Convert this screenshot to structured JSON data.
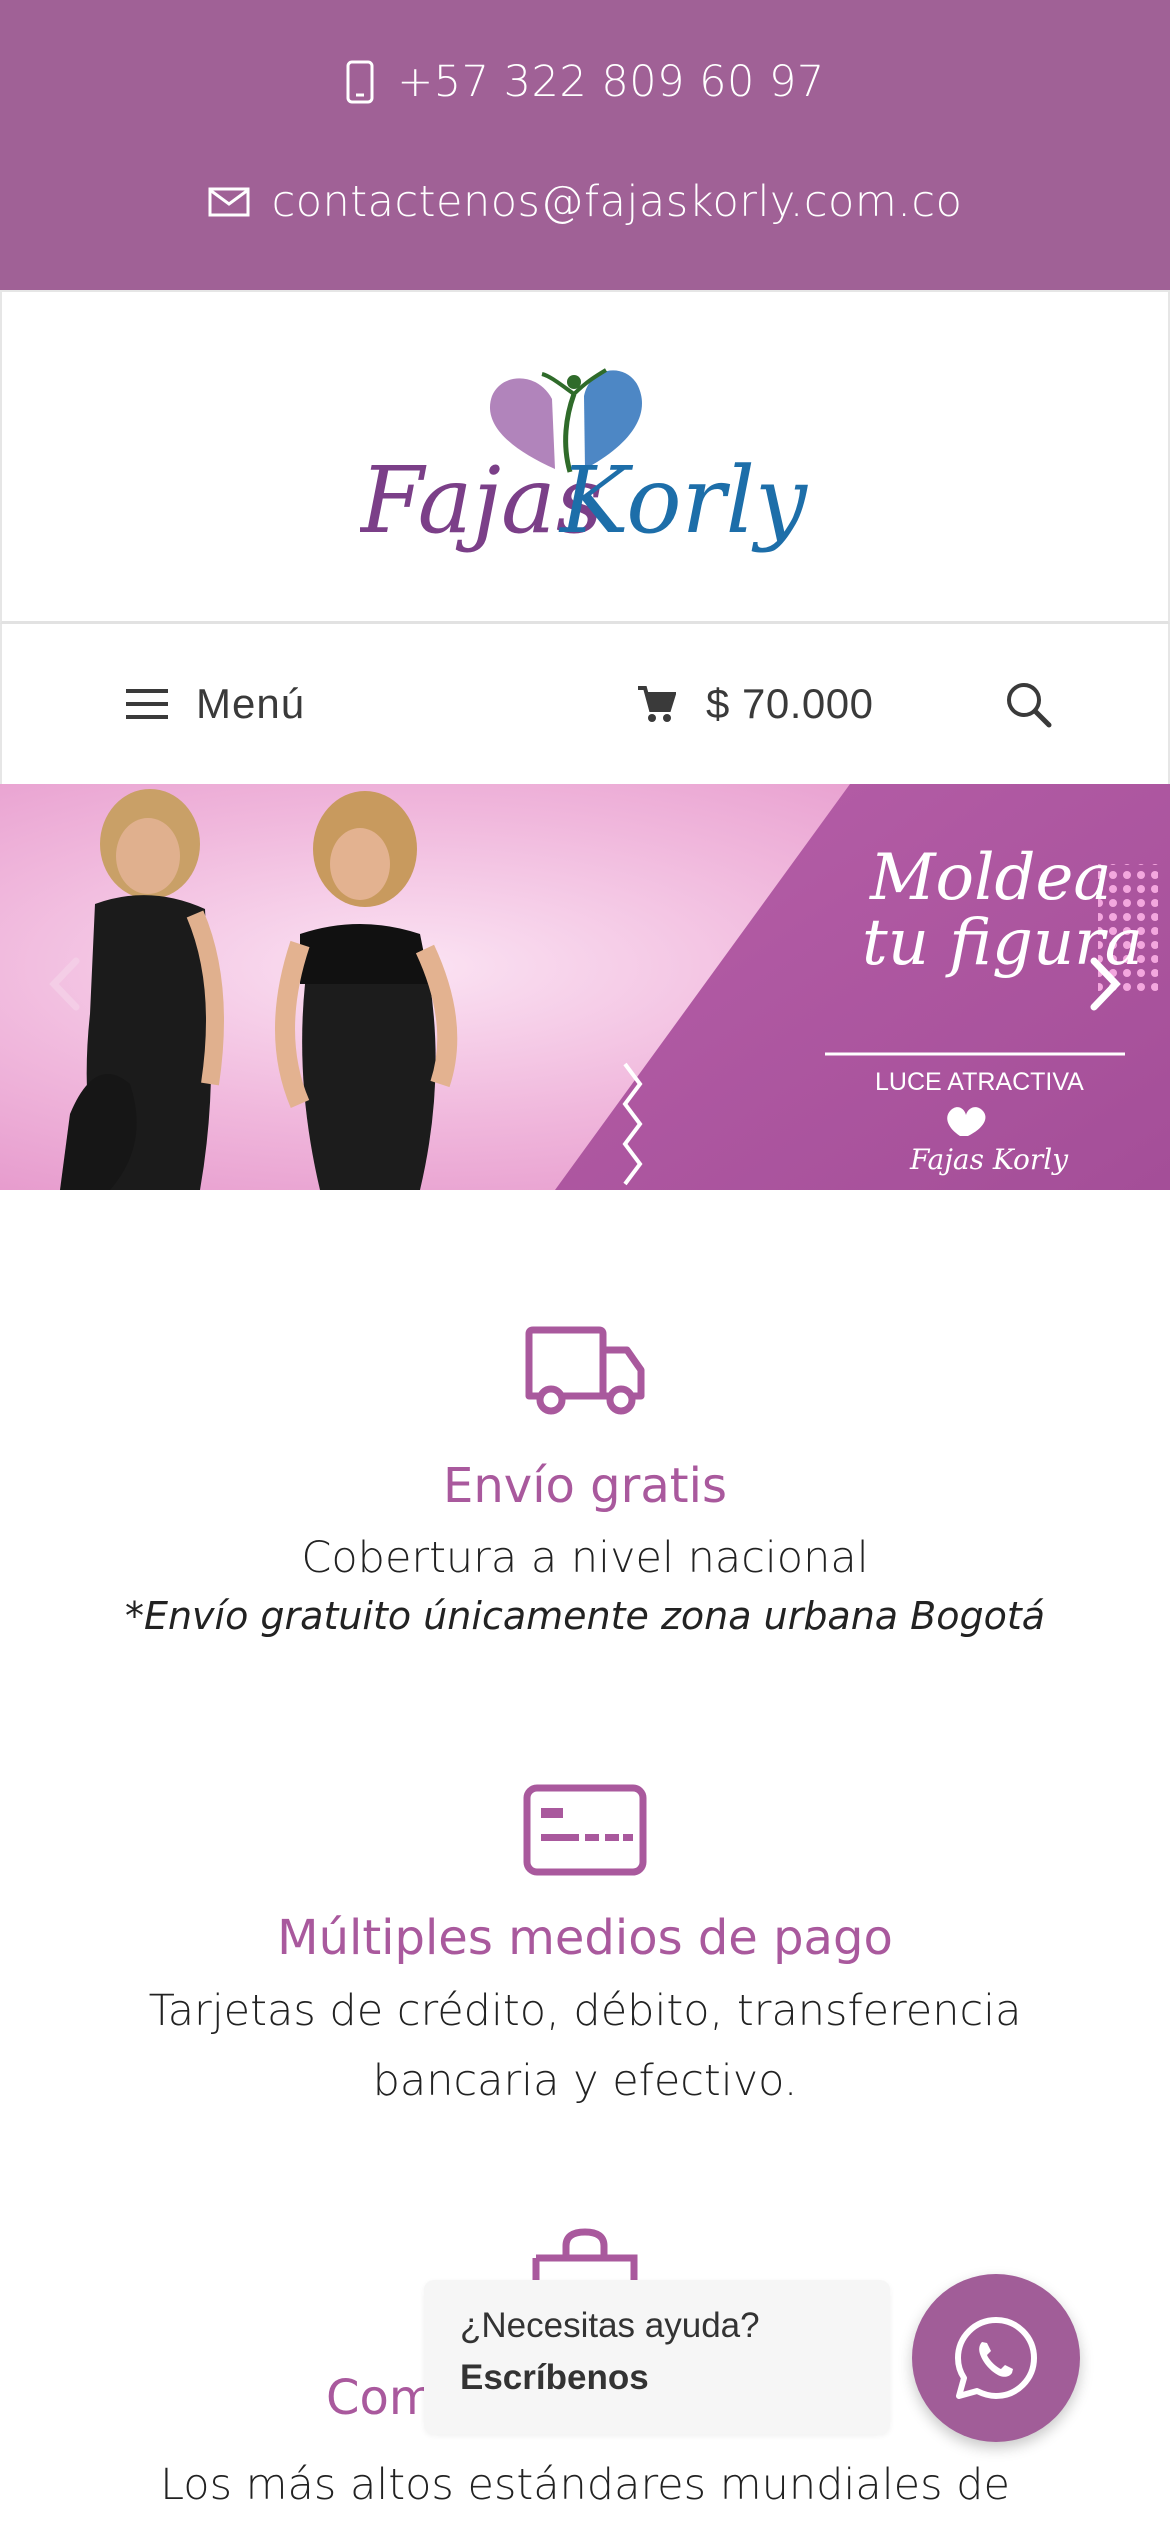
{
  "topbar": {
    "phone": "+57 322 809 60 97",
    "email": "contactenos@fajaskorly.com.co",
    "phone_icon": "phone-icon",
    "email_icon": "envelope-icon",
    "background": "#a06196"
  },
  "logo": {
    "left_word": "Fajas",
    "right_word": "Korly"
  },
  "nav": {
    "menu_label": "Menú",
    "cart_total": "$ 70.000",
    "menu_icon": "hamburger-icon",
    "cart_icon": "cart-icon",
    "search_icon": "search-icon"
  },
  "banner": {
    "headline_1": "Moldea",
    "headline_2": "tu figura",
    "tagline": "LUCE ATRACTIVA",
    "brand": "Fajas Korly",
    "prev_icon": "chevron-left-icon",
    "next_icon": "chevron-right-icon"
  },
  "features": [
    {
      "icon": "truck-icon",
      "title": "Envío gratis",
      "description": "Cobertura a nivel nacional",
      "note": "*Envío gratuito únicamente zona urbana Bogotá"
    },
    {
      "icon": "credit-card-icon",
      "title": "Múltiples medios de pago",
      "description": "Tarjetas de crédito, débito, transferencia bancaria y efectivo."
    },
    {
      "icon": "shopping-bag-icon",
      "title": "Com",
      "description": "Los más altos estándares mundiales de seguridad"
    }
  ],
  "chat": {
    "question": "¿Necesitas ayuda?",
    "cta": "Escríbenos",
    "icon": "whatsapp-icon"
  },
  "colors": {
    "accent": "#a9599d",
    "whatsapp_button": "#a15d98"
  }
}
